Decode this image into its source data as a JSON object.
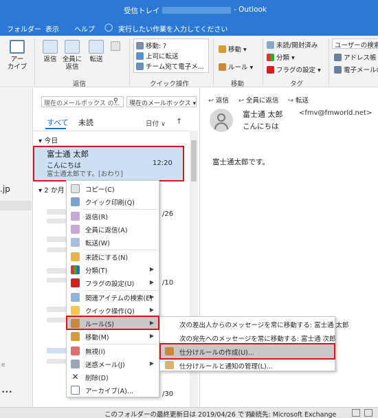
{
  "window": {
    "title_left": "受信トレイ - ",
    "title_app": "- Outlook"
  },
  "menu": {
    "items": [
      "フォルダー",
      "表示",
      "ヘルプ"
    ],
    "tell_me": "実行したい作業を入力してください"
  },
  "ribbon": {
    "archive": "アー\nカイブ",
    "reply": "返信",
    "reply_all": "全員に\n返信",
    "forward": "転送",
    "respond_group": "返信",
    "quick_steps": [
      "移動: ?",
      "上司に転送",
      "チーム宛て電子メ..."
    ],
    "quick_group": "クイック操作",
    "move": "移動",
    "rules": "ルール",
    "move_group": "移動",
    "unread": "未読/開封済み",
    "categorize": "分類",
    "followup": "フラグの設定",
    "tags_group": "タグ",
    "search_people": "ユーザーの検索",
    "address_book": "アドレス帳",
    "filter_email": "電子メールの"
  },
  "list": {
    "search_placeholder": "現在のメールボックス の...",
    "scope": "現在のメールボックス",
    "tab_all": "すべて",
    "tab_unread": "未読",
    "sort": "日付",
    "group_today": "今日",
    "group_2months": "2 か月",
    "selected_sender": "富士通 太郎",
    "selected_subject": "こんにちは",
    "selected_preview": "富士通太郎です。[おわり]",
    "selected_time": "12:20",
    "dates": [
      "/26",
      "/10",
      "/30"
    ]
  },
  "left_partial": ".jp",
  "reading": {
    "reply": "返信",
    "reply_all": "全員に返信",
    "forward": "転送",
    "sender": "富士通 太郎",
    "sender_email": "<fmv@fmworld.net>",
    "subject": "こんにちは",
    "body": "富士通太郎です。"
  },
  "context_menu": [
    "コピー(C)",
    "クイック印刷(Q)",
    "返信(R)",
    "全員に返信(A)",
    "転送(W)",
    "未読にする(N)",
    "分類(T)",
    "フラグの設定(U)",
    "関連アイテムの検索(E)",
    "クイック操作(Q)",
    "ルール(S)",
    "移動(M)",
    "無視(I)",
    "迷惑メール(J)",
    "削除(D)",
    "アーカイブ(A)..."
  ],
  "submenu": [
    "次の差出人からのメッセージを常に移動する: 富士通 太郎",
    "次の宛先へのメッセージを常に移動する: 富士通 次郎",
    "仕分けルールの作成(U)...",
    "仕分けルールと通知の管理(L)..."
  ],
  "status": {
    "updated": "このフォルダーの最終更新日は 2019/04/26 です。",
    "connection": "接続先: Microsoft Exchange"
  },
  "colors": {
    "accent": "#2b79d4",
    "highlight_red": "#d9121b",
    "selected_row": "#cde0f3"
  }
}
